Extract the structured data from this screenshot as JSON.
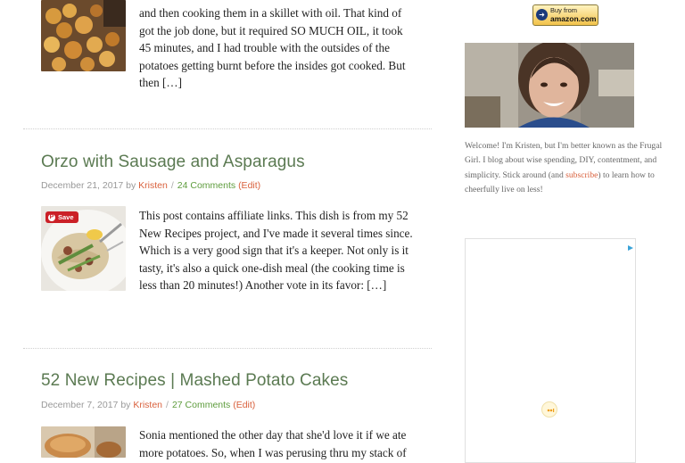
{
  "posts": [
    {
      "excerpt": "and then cooking them in a skillet with oil. That kind of got the job done, but it required SO MUCH OIL, it took 45 minutes, and I had trouble with the outsides of the potatoes getting burnt before the insides got cooked. But then […]"
    },
    {
      "title": "Orzo with Sausage and Asparagus",
      "date": "December 21, 2017",
      "by": "by",
      "author": "Kristen",
      "sep": "/",
      "comments": "24 Comments",
      "edit": "(Edit)",
      "save_label": "Save",
      "excerpt": "This post contains affiliate links. This dish is from my 52 New Recipes project, and I've made it several times since. Which is a very good sign that it's a keeper. Not only is it tasty, it's also a quick one-dish meal (the cooking time is less than 20 minutes!) Another vote in its favor: […]"
    },
    {
      "title": "52 New Recipes | Mashed Potato Cakes",
      "date": "December 7, 2017",
      "by": "by",
      "author": "Kristen",
      "sep": "/",
      "comments": "27 Comments",
      "edit": "(Edit)",
      "excerpt": "Sonia mentioned the other day that she'd love it if we ate more potatoes. So, when I was perusing thru my stack of"
    }
  ],
  "sidebar": {
    "amazon_buy_from": "Buy from",
    "amazon_brand": "amazon.com",
    "welcome_pre": "Welcome! I'm Kristen, but I'm better known as the Frugal Girl. I blog about wise spending, DIY, contentment, and simplicity. Stick around (and ",
    "welcome_link": "subscribe",
    "welcome_post": ") to learn how to cheerfully live on less!"
  },
  "colors": {
    "title_green": "#5b7a52",
    "link_orange": "#d9613d",
    "comments_green": "#5e9c3d",
    "pinterest_red": "#cb2027"
  }
}
